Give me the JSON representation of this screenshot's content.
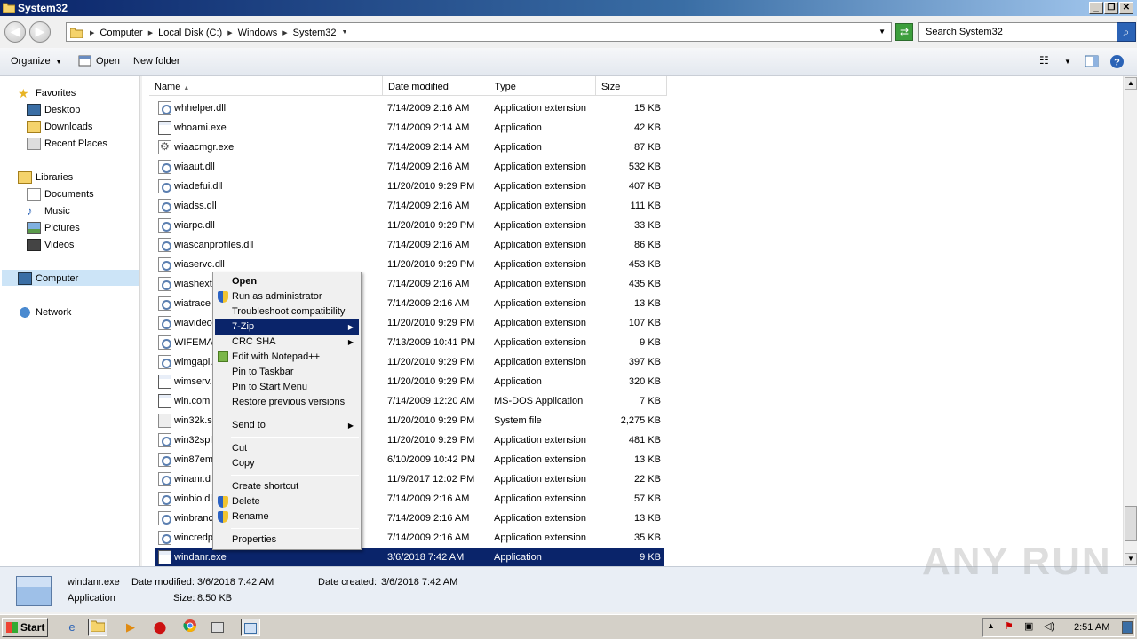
{
  "window": {
    "title": "System32"
  },
  "address": {
    "crumbs": [
      "Computer",
      "Local Disk (C:)",
      "Windows",
      "System32"
    ],
    "search_placeholder": "Search System32"
  },
  "toolbar": {
    "organize": "Organize",
    "open": "Open",
    "new_folder": "New folder"
  },
  "nav": {
    "favorites": "Favorites",
    "desktop": "Desktop",
    "downloads": "Downloads",
    "recent": "Recent Places",
    "libraries": "Libraries",
    "documents": "Documents",
    "music": "Music",
    "pictures": "Pictures",
    "videos": "Videos",
    "computer": "Computer",
    "network": "Network"
  },
  "columns": {
    "name": "Name",
    "date": "Date modified",
    "type": "Type",
    "size": "Size"
  },
  "files": [
    {
      "name": "whhelper.dll",
      "date": "7/14/2009 2:16 AM",
      "type": "Application extension",
      "size": "15 KB",
      "icon": "dll"
    },
    {
      "name": "whoami.exe",
      "date": "7/14/2009 2:14 AM",
      "type": "Application",
      "size": "42 KB",
      "icon": "exe"
    },
    {
      "name": "wiaacmgr.exe",
      "date": "7/14/2009 2:14 AM",
      "type": "Application",
      "size": "87 KB",
      "icon": "gear"
    },
    {
      "name": "wiaaut.dll",
      "date": "7/14/2009 2:16 AM",
      "type": "Application extension",
      "size": "532 KB",
      "icon": "dll"
    },
    {
      "name": "wiadefui.dll",
      "date": "11/20/2010 9:29 PM",
      "type": "Application extension",
      "size": "407 KB",
      "icon": "dll"
    },
    {
      "name": "wiadss.dll",
      "date": "7/14/2009 2:16 AM",
      "type": "Application extension",
      "size": "111 KB",
      "icon": "dll"
    },
    {
      "name": "wiarpc.dll",
      "date": "11/20/2010 9:29 PM",
      "type": "Application extension",
      "size": "33 KB",
      "icon": "dll"
    },
    {
      "name": "wiascanprofiles.dll",
      "date": "7/14/2009 2:16 AM",
      "type": "Application extension",
      "size": "86 KB",
      "icon": "dll"
    },
    {
      "name": "wiaservc.dll",
      "date": "11/20/2010 9:29 PM",
      "type": "Application extension",
      "size": "453 KB",
      "icon": "dll"
    },
    {
      "name": "wiashext",
      "date": "7/14/2009 2:16 AM",
      "type": "Application extension",
      "size": "435 KB",
      "icon": "dll"
    },
    {
      "name": "wiatrace",
      "date": "7/14/2009 2:16 AM",
      "type": "Application extension",
      "size": "13 KB",
      "icon": "dll"
    },
    {
      "name": "wiavideo",
      "date": "11/20/2010 9:29 PM",
      "type": "Application extension",
      "size": "107 KB",
      "icon": "dll"
    },
    {
      "name": "WIFEMA",
      "date": "7/13/2009 10:41 PM",
      "type": "Application extension",
      "size": "9 KB",
      "icon": "dll"
    },
    {
      "name": "wimgapi.",
      "date": "11/20/2010 9:29 PM",
      "type": "Application extension",
      "size": "397 KB",
      "icon": "dll"
    },
    {
      "name": "wimserv.",
      "date": "11/20/2010 9:29 PM",
      "type": "Application",
      "size": "320 KB",
      "icon": "exe"
    },
    {
      "name": "win.com",
      "date": "7/14/2009 12:20 AM",
      "type": "MS-DOS Application",
      "size": "7 KB",
      "icon": "exe"
    },
    {
      "name": "win32k.s",
      "date": "11/20/2010 9:29 PM",
      "type": "System file",
      "size": "2,275 KB",
      "icon": "sys"
    },
    {
      "name": "win32spl",
      "date": "11/20/2010 9:29 PM",
      "type": "Application extension",
      "size": "481 KB",
      "icon": "dll"
    },
    {
      "name": "win87em",
      "date": "6/10/2009 10:42 PM",
      "type": "Application extension",
      "size": "13 KB",
      "icon": "dll"
    },
    {
      "name": "winanr.d",
      "date": "11/9/2017 12:02 PM",
      "type": "Application extension",
      "size": "22 KB",
      "icon": "dll"
    },
    {
      "name": "winbio.dl",
      "date": "7/14/2009 2:16 AM",
      "type": "Application extension",
      "size": "57 KB",
      "icon": "dll"
    },
    {
      "name": "winbranc",
      "date": "7/14/2009 2:16 AM",
      "type": "Application extension",
      "size": "13 KB",
      "icon": "dll"
    },
    {
      "name": "wincredp",
      "date": "7/14/2009 2:16 AM",
      "type": "Application extension",
      "size": "35 KB",
      "icon": "dll"
    },
    {
      "name": "windanr.exe",
      "date": "3/6/2018 7:42 AM",
      "type": "Application",
      "size": "9 KB",
      "icon": "exe",
      "selected": true
    }
  ],
  "context_menu": [
    {
      "label": "Open",
      "bold": true
    },
    {
      "label": "Run as administrator",
      "icon": "shield"
    },
    {
      "label": "Troubleshoot compatibility"
    },
    {
      "label": "7-Zip",
      "submenu": true,
      "highlighted": true
    },
    {
      "label": "CRC SHA",
      "submenu": true
    },
    {
      "label": "Edit with Notepad++",
      "icon": "npp"
    },
    {
      "label": "Pin to Taskbar"
    },
    {
      "label": "Pin to Start Menu"
    },
    {
      "label": "Restore previous versions"
    },
    {
      "separator": true
    },
    {
      "label": "Send to",
      "submenu": true
    },
    {
      "separator": true
    },
    {
      "label": "Cut"
    },
    {
      "label": "Copy"
    },
    {
      "separator": true
    },
    {
      "label": "Create shortcut"
    },
    {
      "label": "Delete",
      "icon": "shield"
    },
    {
      "label": "Rename",
      "icon": "shield"
    },
    {
      "separator": true
    },
    {
      "label": "Properties"
    }
  ],
  "details": {
    "name": "windanr.exe",
    "type": "Application",
    "modified_label": "Date modified:",
    "modified": "3/6/2018 7:42 AM",
    "created_label": "Date created:",
    "created": "3/6/2018 7:42 AM",
    "size_label": "Size:",
    "size": "8.50 KB"
  },
  "watermark": "ANY RUN",
  "taskbar": {
    "start": "Start",
    "clock": "2:51 AM"
  }
}
